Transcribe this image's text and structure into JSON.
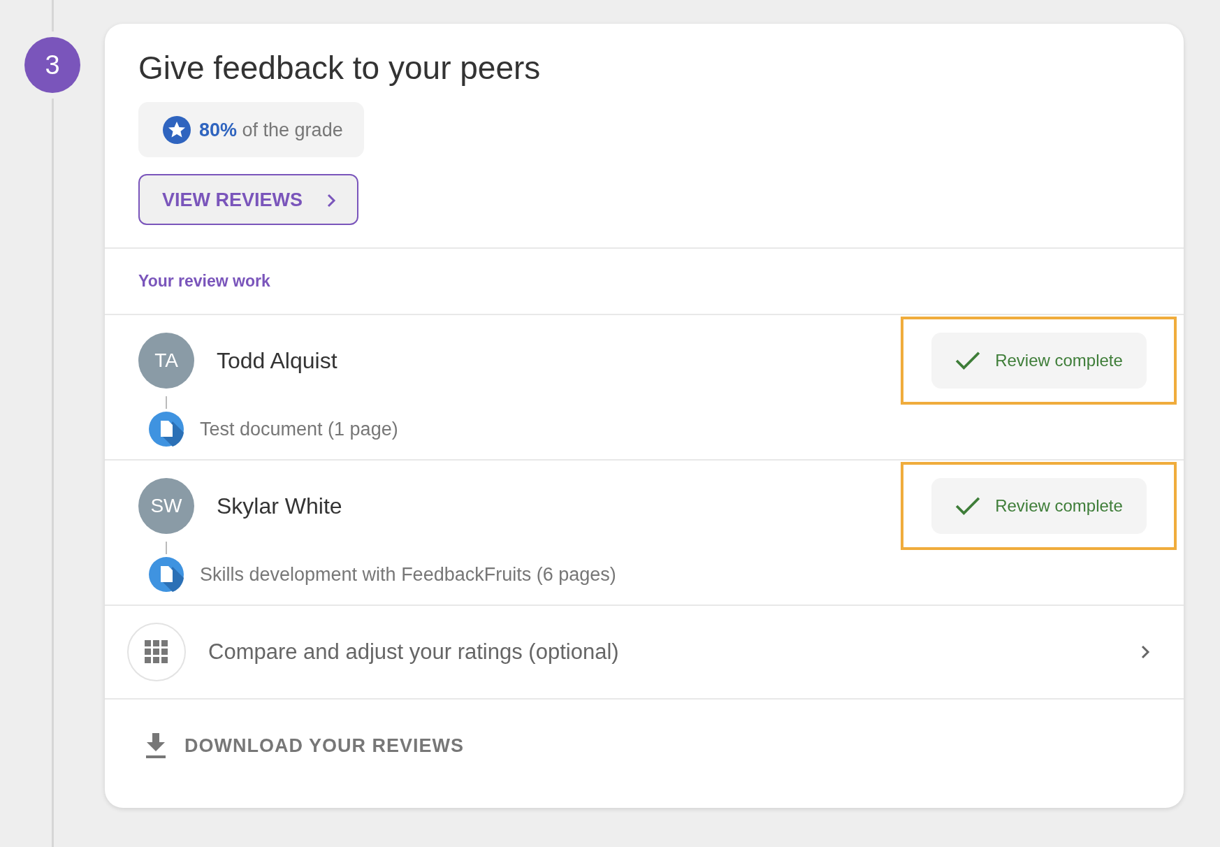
{
  "step": {
    "number": "3"
  },
  "card": {
    "title": "Give feedback to your peers",
    "grade": {
      "percent": "80%",
      "text": "of the grade"
    },
    "view_button": {
      "label": "VIEW REVIEWS"
    },
    "section_label": "Your review work",
    "reviewers": [
      {
        "initials": "TA",
        "name": "Todd Alquist",
        "document": "Test document (1 page)",
        "status": "Review complete",
        "complete": true,
        "highlighted": true
      },
      {
        "initials": "SW",
        "name": "Skylar White",
        "document": "Skills development with FeedbackFruits (6 pages)",
        "status": "Review complete",
        "complete": true,
        "highlighted": true
      }
    ],
    "compare_row": {
      "label": "Compare and adjust your ratings (optional)"
    },
    "download": {
      "label": "DOWNLOAD YOUR REVIEWS"
    }
  }
}
